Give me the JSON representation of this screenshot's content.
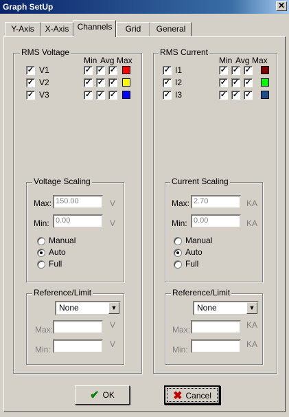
{
  "window": {
    "title": "Graph SetUp",
    "close_glyph": "✕"
  },
  "tabs": [
    {
      "label": "Y-Axis"
    },
    {
      "label": "X-Axis"
    },
    {
      "label": "Channels"
    },
    {
      "label": "Grid"
    },
    {
      "label": "General"
    }
  ],
  "active_tab": "Channels",
  "voltage": {
    "title": "RMS Voltage",
    "headers": [
      "Min",
      "Avg",
      "Max"
    ],
    "channels": [
      {
        "label": "V1",
        "color": "#ff0000"
      },
      {
        "label": "V2",
        "color": "#ffff00"
      },
      {
        "label": "V3",
        "color": "#0000ff"
      }
    ],
    "scaling": {
      "title": "Voltage Scaling",
      "max_label": "Max:",
      "max_value": "150.00",
      "max_unit": "V",
      "min_label": "Min:",
      "min_value": "0.00",
      "min_unit": "V",
      "options": [
        "Manual",
        "Auto",
        "Full"
      ],
      "selected": "Auto"
    },
    "reference": {
      "title": "Reference/Limit",
      "selected": "None",
      "max_label": "Max:",
      "max_unit": "V",
      "min_label": "Min:",
      "min_unit": "V"
    }
  },
  "current": {
    "title": "RMS Current",
    "headers": [
      "Min",
      "Avg",
      "Max"
    ],
    "channels": [
      {
        "label": "I1",
        "color": "#800000"
      },
      {
        "label": "I2",
        "color": "#00ff00"
      },
      {
        "label": "I3",
        "color": "#1f4f8a"
      }
    ],
    "scaling": {
      "title": "Current Scaling",
      "max_label": "Max:",
      "max_value": "2.70",
      "max_unit": "KA",
      "min_label": "Min:",
      "min_value": "0.00",
      "min_unit": "KA",
      "options": [
        "Manual",
        "Auto",
        "Full"
      ],
      "selected": "Auto"
    },
    "reference": {
      "title": "Reference/Limit",
      "selected": "None",
      "max_label": "Max:",
      "max_unit": "KA",
      "min_label": "Min:",
      "min_unit": "KA"
    }
  },
  "buttons": {
    "ok_label": "OK",
    "ok_icon": "checkmark-icon",
    "cancel_label": "Cancel",
    "cancel_icon": "x-icon"
  },
  "check_glyph": "✓"
}
